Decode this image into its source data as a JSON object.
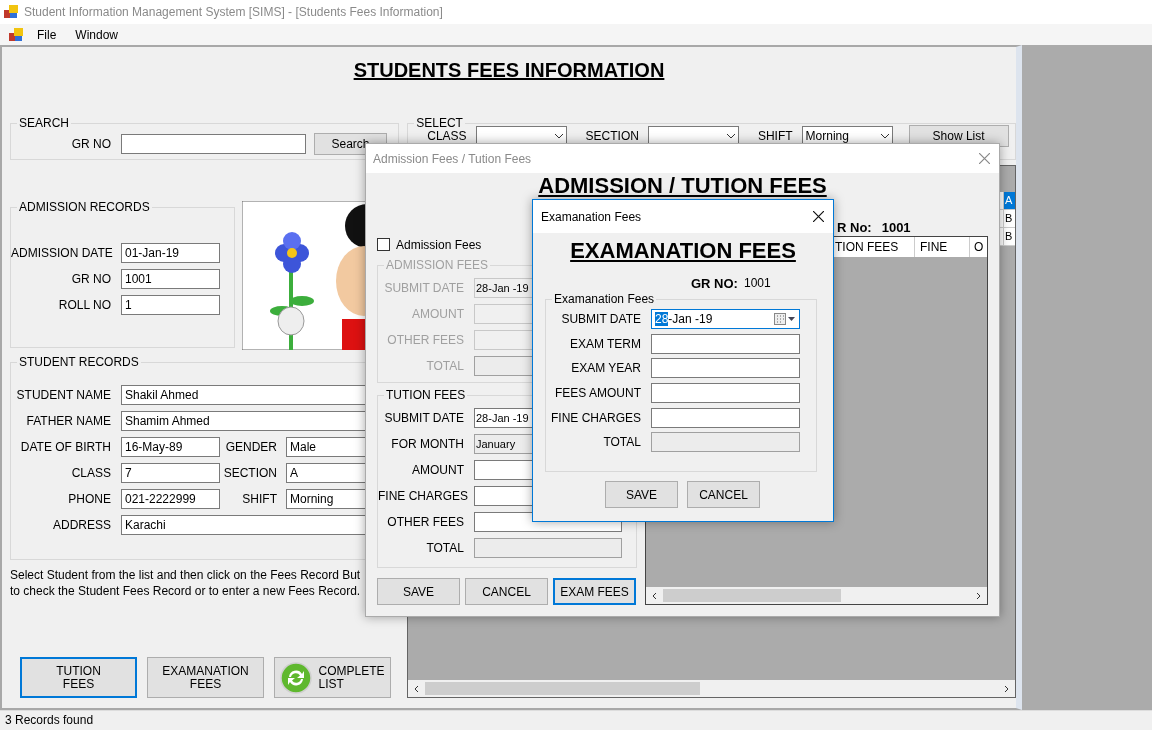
{
  "window": {
    "title": "Student Information Management System [SIMS] - [Students Fees Information]"
  },
  "menu": [
    {
      "label": "File"
    },
    {
      "label": "Window"
    }
  ],
  "fees_form": {
    "heading": "STUDENTS FEES INFORMATION",
    "search": {
      "legend": "SEARCH",
      "label": "GR NO",
      "button": "Search"
    },
    "select": {
      "legend": "SELECT",
      "fields": [
        {
          "label": "CLASS"
        },
        {
          "label": "SECTION"
        },
        {
          "label": "SHIFT",
          "value": "Morning"
        }
      ],
      "button": "Show List"
    },
    "admission_records": {
      "legend": "ADMISSION RECORDS",
      "fields": [
        {
          "label": "ADMISSION DATE",
          "value": "01-Jan-19"
        },
        {
          "label": "GR NO",
          "value": "1001"
        },
        {
          "label": "ROLL NO",
          "value": "1"
        }
      ]
    },
    "student_records": {
      "legend": "STUDENT RECORDS",
      "rows": [
        [
          {
            "label": "STUDENT NAME",
            "value": "Shakil Ahmed"
          }
        ],
        [
          {
            "label": "FATHER NAME",
            "value": "Shamim Ahmed"
          }
        ],
        [
          {
            "label": "DATE OF BIRTH",
            "value": "16-May-89"
          },
          {
            "label": "GENDER",
            "value": "Male"
          }
        ],
        [
          {
            "label": "CLASS",
            "value": "7"
          },
          {
            "label": "SECTION",
            "value": "A"
          }
        ],
        [
          {
            "label": "PHONE",
            "value": "021-2222999"
          },
          {
            "label": "SHIFT",
            "value": "Morning"
          }
        ],
        [
          {
            "label": "ADDRESS",
            "value": "Karachi"
          }
        ]
      ]
    },
    "instructions": "Select Student from the list and then click on the Fees Record But\nto check the Student Fees Record or to enter a new Fees Record.",
    "buttons": [
      {
        "label": "TUTION\nFEES",
        "kind": "text",
        "focused": true
      },
      {
        "label": "EXAMANATION\nFEES",
        "kind": "text",
        "focused": false
      },
      {
        "label": "COMPLETE\nLIST",
        "kind": "icon",
        "focused": false
      }
    ],
    "grid": {
      "rows": [
        {
          "column_1": "A",
          "selected": true
        },
        {
          "column_1": "B",
          "selected": false
        },
        {
          "column_1": "B",
          "selected": false
        }
      ]
    }
  },
  "fees_dialog": {
    "title": "Admission Fees / Tution Fees",
    "heading": "ADMISSION / TUTION FEES",
    "admission_checkbox": {
      "label": "Admission Fees",
      "checked": false
    },
    "admission_group": {
      "legend": "ADMISSION FEES",
      "disabled": true,
      "fields": [
        {
          "label": "SUBMIT DATE",
          "kind": "date",
          "value": "28-Jan -19"
        },
        {
          "label": "AMOUNT",
          "kind": "text"
        },
        {
          "label": "OTHER FEES",
          "kind": "text"
        },
        {
          "label": "TOTAL",
          "kind": "readonly"
        }
      ]
    },
    "tuition_group": {
      "legend": "TUTION FEES",
      "disabled": false,
      "fields": [
        {
          "label": "SUBMIT DATE",
          "kind": "date",
          "value": "28-Jan -19"
        },
        {
          "label": "FOR MONTH",
          "kind": "combo",
          "value": "January"
        },
        {
          "label": "AMOUNT",
          "kind": "text"
        },
        {
          "label": "FINE CHARGES",
          "kind": "text"
        },
        {
          "label": "OTHER FEES",
          "kind": "text"
        },
        {
          "label": "TOTAL",
          "kind": "readonly"
        }
      ]
    },
    "gr": {
      "label": "R No:",
      "value": "1001"
    },
    "columns": [
      "TION FEES",
      "FINE",
      "O"
    ],
    "buttons": [
      {
        "label": "SAVE",
        "focused": false
      },
      {
        "label": "CANCEL",
        "focused": false
      },
      {
        "label": "EXAM FEES",
        "focused": true
      }
    ]
  },
  "exam_dialog": {
    "title": "Examanation Fees",
    "heading": "EXAMANATION FEES",
    "gr": {
      "label": "GR NO:",
      "value": "1001"
    },
    "group": {
      "legend": "Examanation Fees",
      "fields": [
        {
          "label": "SUBMIT DATE",
          "kind": "date",
          "selection": "28",
          "value": "-Jan -19",
          "focused": true
        },
        {
          "label": "EXAM TERM",
          "kind": "text",
          "focused": false
        },
        {
          "label": "EXAM YEAR",
          "kind": "text",
          "focused": false
        },
        {
          "label": "FEES AMOUNT",
          "kind": "text",
          "focused": false
        },
        {
          "label": "FINE CHARGES",
          "kind": "text",
          "focused": false
        },
        {
          "label": "TOTAL",
          "kind": "readonly",
          "focused": false
        }
      ]
    },
    "buttons": [
      {
        "label": "SAVE",
        "focused": false
      },
      {
        "label": "CANCEL",
        "focused": false
      }
    ]
  },
  "status_bar": "3 Records found"
}
